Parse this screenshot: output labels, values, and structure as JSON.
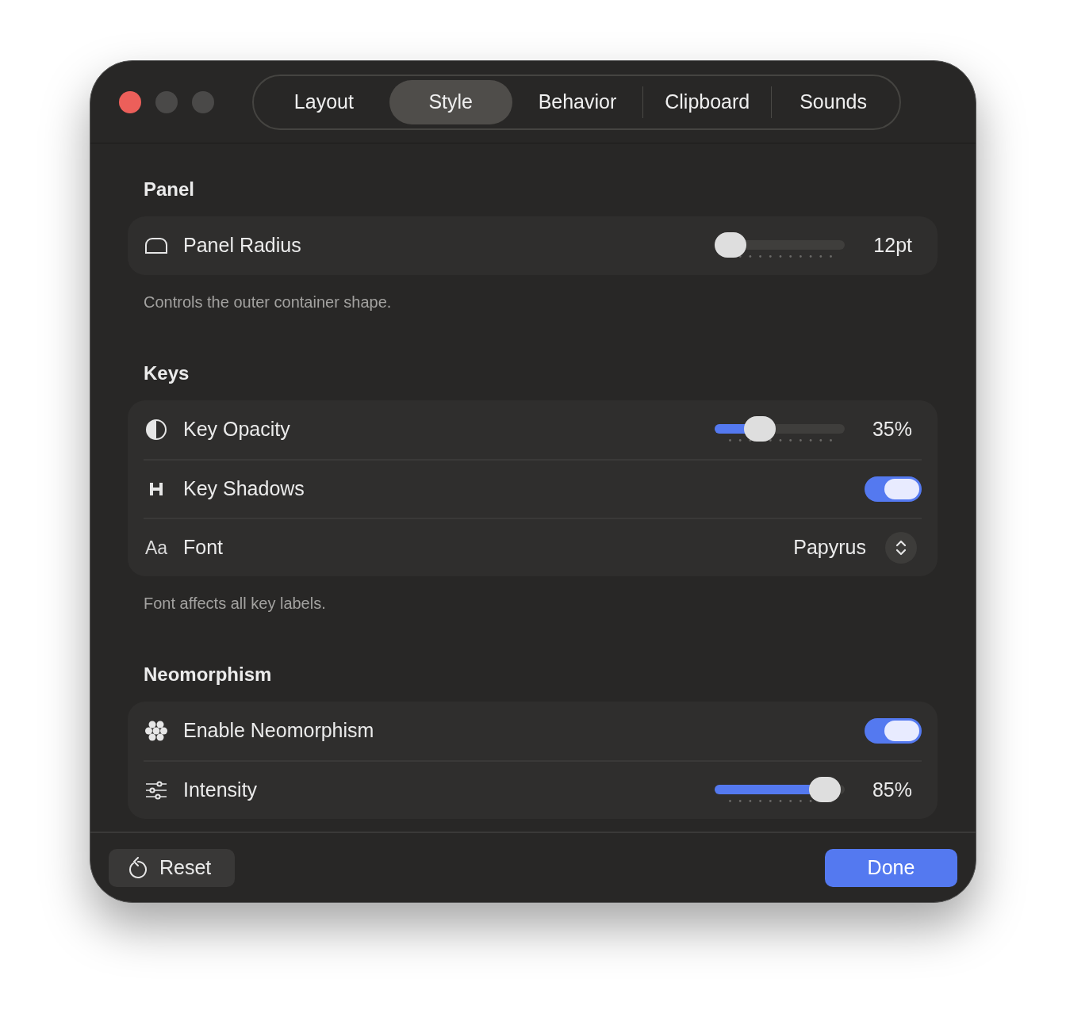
{
  "tabs": [
    {
      "label": "Layout",
      "selected": false
    },
    {
      "label": "Style",
      "selected": true
    },
    {
      "label": "Behavior",
      "selected": false
    },
    {
      "label": "Clipboard",
      "selected": false
    },
    {
      "label": "Sounds",
      "selected": false
    }
  ],
  "sections": [
    {
      "title": "Panel",
      "rows": [
        {
          "kind": "slider",
          "label": "Panel Radius",
          "level": 0,
          "value": "12pt"
        }
      ],
      "note": "Controls the outer container shape."
    },
    {
      "title": "Keys",
      "rows": [
        {
          "kind": "slider",
          "label": "Key Opacity",
          "level": 0.35,
          "value": "35%"
        },
        {
          "kind": "toggle",
          "label": "Key Shadows",
          "on": true
        },
        {
          "kind": "select",
          "icon_text": "Aa",
          "label": "Font",
          "value": "Papyrus"
        }
      ],
      "note": "Font affects all key labels."
    },
    {
      "title": "Neomorphism",
      "rows": [
        {
          "kind": "toggle",
          "label": "Enable Neomorphism",
          "on": true
        },
        {
          "kind": "slider",
          "label": "Intensity",
          "level": 0.85,
          "value": "85%"
        }
      ]
    }
  ],
  "footer": {
    "reset": "Reset",
    "done": "Done"
  }
}
